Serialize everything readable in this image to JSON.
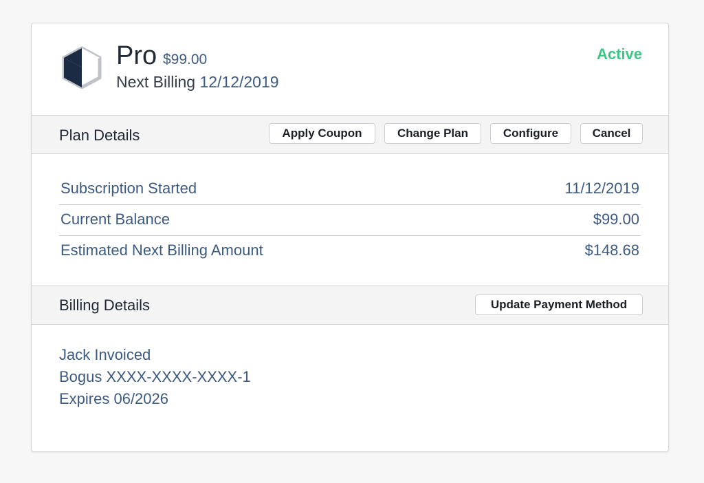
{
  "plan": {
    "name": "Pro",
    "price": "$99.00",
    "next_billing_label": "Next Billing",
    "next_billing_date": "12/12/2019",
    "status": "Active",
    "status_color": "#3ec484",
    "logo_icon": "cube-icon"
  },
  "plan_details": {
    "title": "Plan Details",
    "buttons": {
      "apply_coupon": "Apply Coupon",
      "change_plan": "Change Plan",
      "configure": "Configure",
      "cancel": "Cancel"
    },
    "rows": [
      {
        "label": "Subscription Started",
        "value": "11/12/2019"
      },
      {
        "label": "Current Balance",
        "value": "$99.00"
      },
      {
        "label": "Estimated Next Billing Amount",
        "value": "$148.68"
      }
    ]
  },
  "billing_details": {
    "title": "Billing Details",
    "update_payment_label": "Update Payment Method",
    "lines": [
      "Jack Invoiced",
      "Bogus XXXX-XXXX-XXXX-1",
      "Expires 06/2026"
    ]
  },
  "colors": {
    "accent_text": "#3d5a80",
    "logo_dark": "#1c2b44",
    "logo_outline": "#bfc2c6"
  }
}
